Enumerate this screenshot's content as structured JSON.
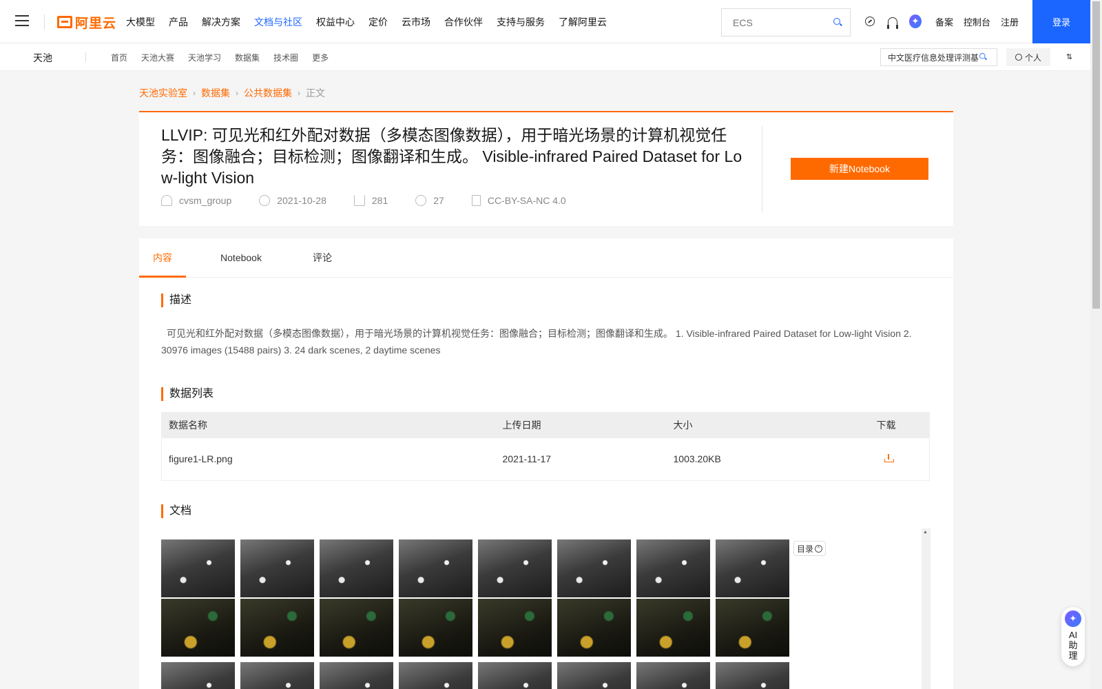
{
  "topnav": {
    "logo": "阿里云",
    "menu": [
      "大模型",
      "产品",
      "解决方案",
      "文档与社区",
      "权益中心",
      "定价",
      "云市场",
      "合作伙伴",
      "支持与服务",
      "了解阿里云"
    ],
    "active_menu": "文档与社区",
    "search_placeholder": "ECS",
    "links": [
      "备案",
      "控制台",
      "注册"
    ],
    "login": "登录"
  },
  "subnav": {
    "brand": "天池",
    "items": [
      "首页",
      "天池大赛",
      "天池学习",
      "数据集",
      "技术圈",
      "更多"
    ],
    "search_value": "中文医疗信息处理评测基",
    "personal": "个人"
  },
  "breadcrumb": [
    "天池实验室",
    "数据集",
    "公共数据集",
    "正文"
  ],
  "dataset": {
    "title": "LLVIP: 可见光和红外配对数据（多模态图像数据），用于暗光场景的计算机视觉任务：图像融合；目标检测；图像翻译和生成。 Visible-infrared Paired Dataset for Low-light Vision",
    "author": "cvsm_group",
    "date": "2021-10-28",
    "downloads": "281",
    "shares": "27",
    "license": "CC-BY-SA-NC 4.0",
    "new_notebook": "新建Notebook"
  },
  "tabs": [
    "内容",
    "Notebook",
    "评论"
  ],
  "sections": {
    "description_title": "描述",
    "description": "可见光和红外配对数据（多模态图像数据），用于暗光场景的计算机视觉任务：图像融合；目标检测；图像翻译和生成。 1. Visible-infrared Paired Dataset for Low-light Vision 2. 30976 images (15488 pairs) 3. 24 dark scenes, 2 daytime scenes",
    "datalist_title": "数据列表",
    "docs_title": "文档"
  },
  "table": {
    "headers": [
      "数据名称",
      "上传日期",
      "大小",
      "下载"
    ],
    "rows": [
      {
        "name": "figure1-LR.png",
        "date": "2021-11-17",
        "size": "1003.20KB"
      }
    ]
  },
  "toc": "目录",
  "ai_helper": "AI助理",
  "colors": {
    "accent": "#ff6a00",
    "brand_blue": "#1a66ff"
  }
}
